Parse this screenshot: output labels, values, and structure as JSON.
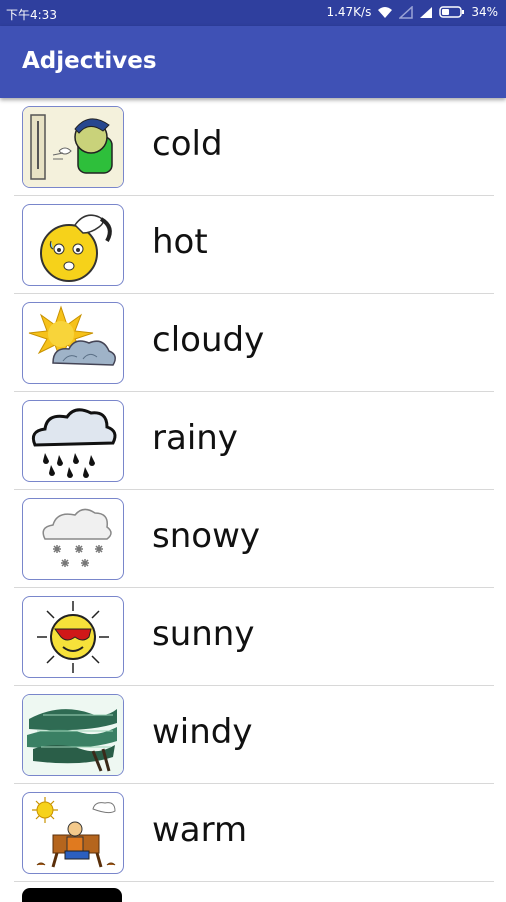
{
  "status_bar": {
    "time": "下午4:33",
    "speed": "1.47K/s",
    "battery": "34%"
  },
  "app_bar": {
    "title": "Adjectives"
  },
  "items": [
    {
      "label": "cold",
      "icon": "cold-person-icon"
    },
    {
      "label": "hot",
      "icon": "hot-sun-face-icon"
    },
    {
      "label": "cloudy",
      "icon": "sun-cloud-icon"
    },
    {
      "label": "rainy",
      "icon": "rain-cloud-icon"
    },
    {
      "label": "snowy",
      "icon": "snow-cloud-icon"
    },
    {
      "label": "sunny",
      "icon": "sun-sunglasses-icon"
    },
    {
      "label": "windy",
      "icon": "wind-trees-icon"
    },
    {
      "label": "warm",
      "icon": "warm-bench-icon"
    }
  ],
  "colors": {
    "status_bar": "#2f3f9e",
    "app_bar": "#3f51b5",
    "thumb_border": "#7986cb",
    "divider": "#d8d8d8"
  }
}
